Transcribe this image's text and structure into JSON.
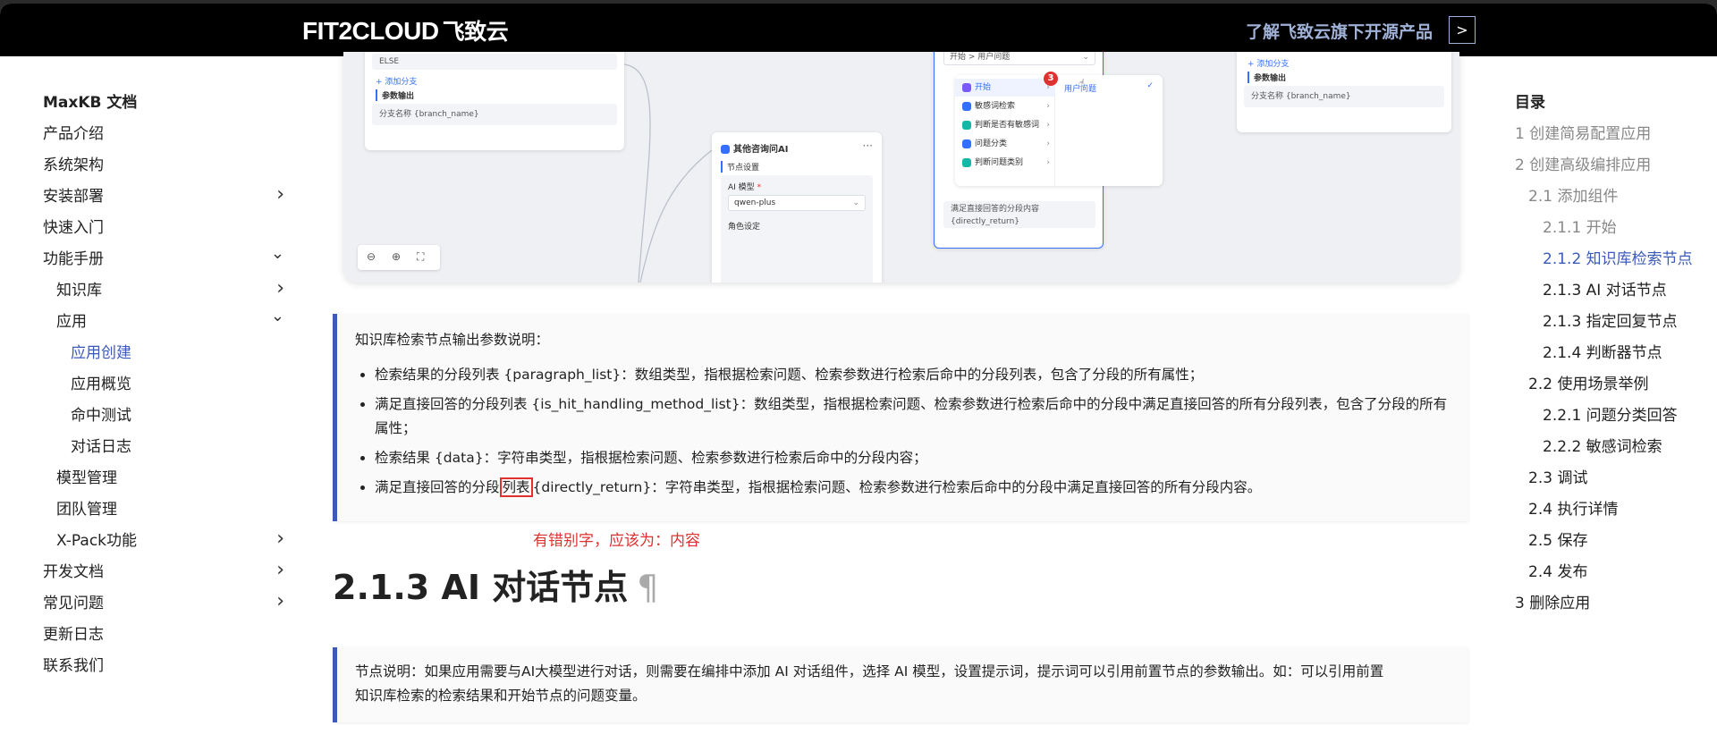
{
  "header": {
    "brand": "FIT2CLOUD",
    "brand_cn": "飞致云",
    "link_text": "了解飞致云旗下开源产品",
    "arrow": ">"
  },
  "sidebar": {
    "items": [
      {
        "label": "MaxKB 文档",
        "level": 1,
        "type": "title"
      },
      {
        "label": "产品介绍",
        "level": 1
      },
      {
        "label": "系统架构",
        "level": 1
      },
      {
        "label": "安装部署",
        "level": 1,
        "chevron": "›"
      },
      {
        "label": "快速入门",
        "level": 1
      },
      {
        "label": "功能手册",
        "level": 1,
        "chevron": "⌄"
      },
      {
        "label": "知识库",
        "level": 2,
        "chevron": "›"
      },
      {
        "label": "应用",
        "level": 2,
        "chevron": "⌄"
      },
      {
        "label": "应用创建",
        "level": 3,
        "active": true
      },
      {
        "label": "应用概览",
        "level": 3
      },
      {
        "label": "命中测试",
        "level": 3
      },
      {
        "label": "对话日志",
        "level": 3
      },
      {
        "label": "模型管理",
        "level": 2
      },
      {
        "label": "团队管理",
        "level": 2
      },
      {
        "label": "X-Pack功能",
        "level": 2,
        "chevron": "›"
      },
      {
        "label": "开发文档",
        "level": 1,
        "chevron": "›"
      },
      {
        "label": "常见问题",
        "level": 1,
        "chevron": "›"
      },
      {
        "label": "更新日志",
        "level": 1
      },
      {
        "label": "联系我们",
        "level": 1
      }
    ]
  },
  "toc": {
    "items": [
      {
        "label": "目录",
        "level": 1,
        "type": "title"
      },
      {
        "label": "1 创建简易配置应用",
        "level": 1
      },
      {
        "label": "2 创建高级编排应用",
        "level": 1
      },
      {
        "label": "2.1 添加组件",
        "level": 2
      },
      {
        "label": "2.1.1 开始",
        "level": 3
      },
      {
        "label": "2.1.2 知识库检索节点",
        "level": 3,
        "active": true
      },
      {
        "label": "2.1.3 AI 对话节点",
        "level": 3,
        "dark": true
      },
      {
        "label": "2.1.3 指定回复节点",
        "level": 3,
        "dark": true
      },
      {
        "label": "2.1.4 判断器节点",
        "level": 3,
        "dark": true
      },
      {
        "label": "2.2 使用场景举例",
        "level": 2,
        "dark": true
      },
      {
        "label": "2.2.1 问题分类回答",
        "level": 3,
        "dark": true
      },
      {
        "label": "2.2.2 敏感词检索",
        "level": 3,
        "dark": true
      },
      {
        "label": "2.3 调试",
        "level": 2,
        "dark": true
      },
      {
        "label": "2.4 执行详情",
        "level": 2,
        "dark": true
      },
      {
        "label": "2.5 保存",
        "level": 2,
        "dark": true
      },
      {
        "label": "2.4 发布",
        "level": 2,
        "dark": true
      },
      {
        "label": "3 删除应用",
        "level": 1,
        "dark": true
      }
    ]
  },
  "canvas": {
    "else_label": "ELSE",
    "add_branch": "+ 添加分支",
    "param_output": "参数输出",
    "branch_name_field": "分支名称 {branch_name}",
    "ai_node_title": "其他咨询问AI",
    "ai_node_menu": "···",
    "node_settings": "节点设置",
    "ai_model_label": "AI 模型",
    "ai_model_required": "*",
    "ai_model_value": "qwen-plus",
    "role_label": "角色设定",
    "dropdown_top": "开始 > 用户问题",
    "menu_items": [
      "开始",
      "敏感词检索",
      "判断是否有敏感词",
      "问题分类",
      "判断问题类别"
    ],
    "menu_badge": "3",
    "menu_sub_item": "用户问题",
    "menu_check": "✓",
    "direct_return_field_line1": "满足直接回答的分段内容",
    "direct_return_field_line2": "{directly_return}",
    "right_add_branch": "+ 添加分支",
    "right_param_output": "参数输出",
    "right_branch_name_field": "分支名称 {branch_name}",
    "zoom_out": "⊖",
    "zoom_in": "⊕",
    "fit": "⛶"
  },
  "info1": {
    "intro": "知识库检索节点输出参数说明：",
    "item1": "检索结果的分段列表 {paragraph_list}：数组类型，指根据检索问题、检索参数进行检索后命中的分段列表，包含了分段的所有属性；",
    "item2": "满足直接回答的分段列表 {is_hit_handling_method_list}：数组类型，指根据检索问题、检索参数进行检索后命中的分段中满足直接回答的所有分段列表，包含了分段的所有属性；",
    "item3": "检索结果 {data}：字符串类型，指根据检索问题、检索参数进行检索后命中的分段内容；",
    "item4_pre": "满足直接回答的分段",
    "item4_hl": "列表",
    "item4_post": "{directly_return}：字符串类型，指根据检索问题、检索参数进行检索后命中的分段中满足直接回答的所有分段内容。"
  },
  "annotation": "有错别字，应该为：内容",
  "section": {
    "title": "2.1.3 AI 对话节点",
    "pilcrow": "¶"
  },
  "info2": {
    "line1": "节点说明：如果应用需要与AI大模型进行对话，则需要在编排中添加 AI 对话组件，选择 AI 模型，设置提示词，提示词可以引用前置节点的参数输出。如：可以引用前置",
    "line2": "知识库检索的检索结果和开始节点的问题变量。"
  },
  "colors": {
    "accent": "#3c5bb8",
    "annotation_red": "#e03131",
    "topbar": "#000000",
    "link_blue": "#9fb1d6"
  }
}
